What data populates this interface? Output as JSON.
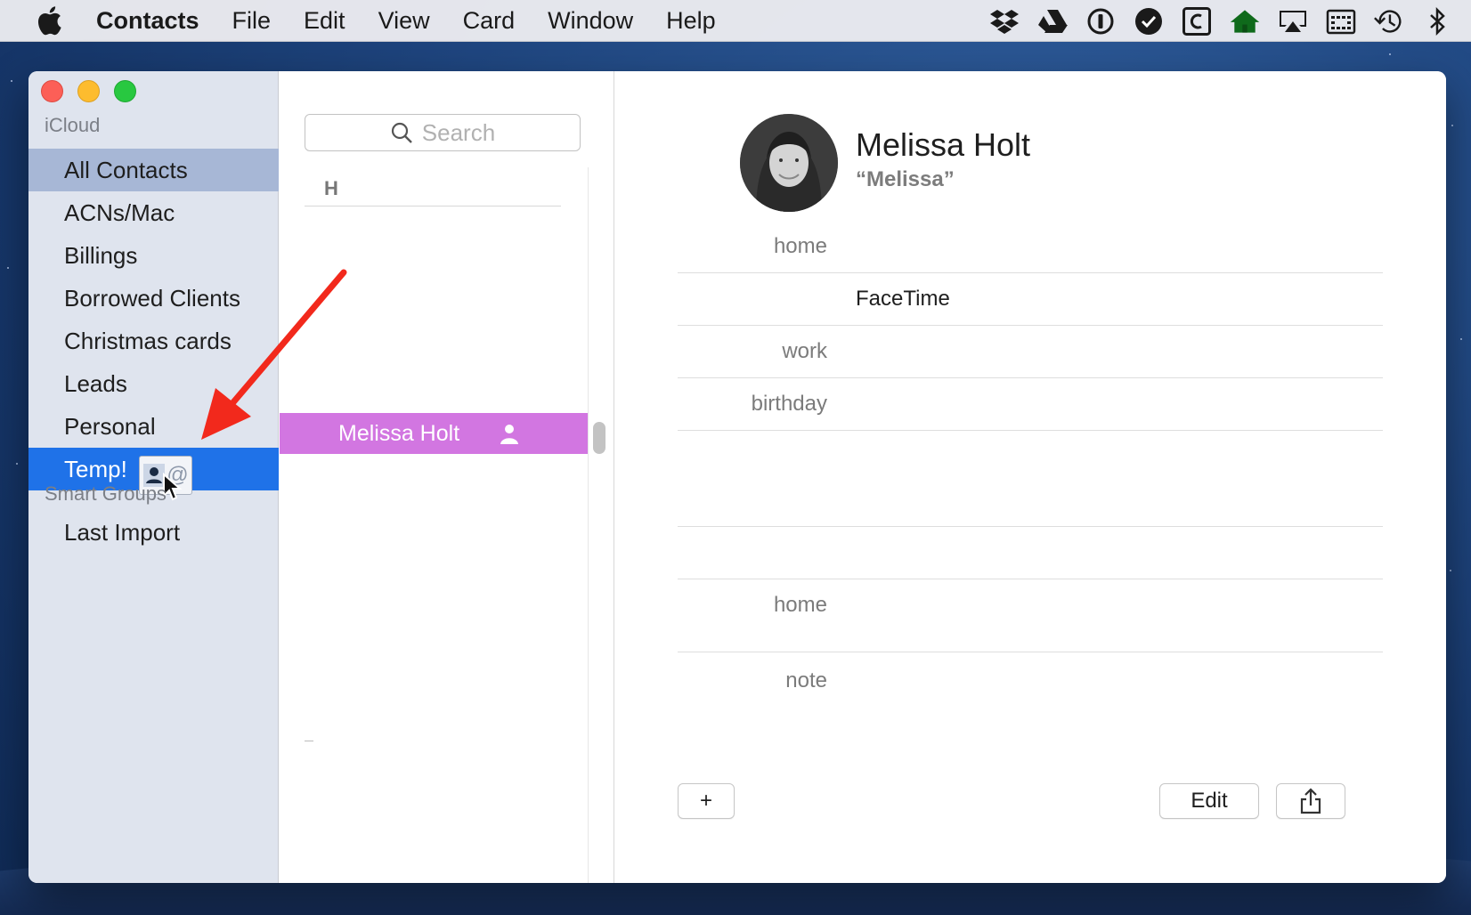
{
  "menubar": {
    "app_name": "Contacts",
    "items": [
      "File",
      "Edit",
      "View",
      "Card",
      "Window",
      "Help"
    ],
    "status_icons": [
      "dropbox-icon",
      "google-drive-icon",
      "onepassword-icon",
      "checkmark-circle-icon",
      "c-box-icon",
      "house-icon",
      "airplay-icon",
      "calendar-grid-icon",
      "time-machine-icon",
      "bluetooth-icon"
    ]
  },
  "sidebar": {
    "account_header": "iCloud",
    "groups": [
      {
        "label": "All Contacts",
        "state": "selected-gray"
      },
      {
        "label": "ACNs/Mac",
        "state": ""
      },
      {
        "label": "Billings",
        "state": ""
      },
      {
        "label": "Borrowed Clients",
        "state": ""
      },
      {
        "label": "Christmas cards",
        "state": ""
      },
      {
        "label": "Leads",
        "state": ""
      },
      {
        "label": "Personal",
        "state": ""
      },
      {
        "label": "Temp!",
        "state": "selected-blue"
      }
    ],
    "smart_header": "Smart Groups",
    "smart_groups": [
      {
        "label": "Last Import"
      }
    ],
    "drag_badge_symbol": "@"
  },
  "list": {
    "search_placeholder": "Search",
    "section_letter": "H",
    "selected_contact": "Melissa Holt"
  },
  "detail": {
    "name": "Melissa Holt",
    "nickname": "“Melissa”",
    "fields": [
      {
        "label": "home",
        "value": ""
      },
      {
        "label": "",
        "value": "FaceTime"
      },
      {
        "label": "work",
        "value": ""
      },
      {
        "label": "birthday",
        "value": ""
      },
      {
        "label": "home",
        "value": ""
      },
      {
        "label": "note",
        "value": ""
      }
    ],
    "add_label": "+",
    "edit_label": "Edit"
  },
  "colors": {
    "selected_blue": "#1f72e8",
    "selected_gray": "#a7b7d6",
    "contact_highlight": "#d276e1",
    "arrow": "#f2291c"
  }
}
